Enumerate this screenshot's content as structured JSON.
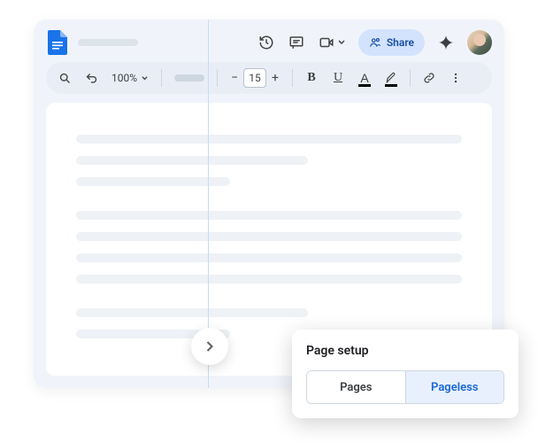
{
  "header": {
    "share_label": "Share"
  },
  "toolbar": {
    "zoom": "100%",
    "font_size": "15"
  },
  "popup": {
    "title": "Page setup",
    "option_pages": "Pages",
    "option_pageless": "Pageless"
  }
}
